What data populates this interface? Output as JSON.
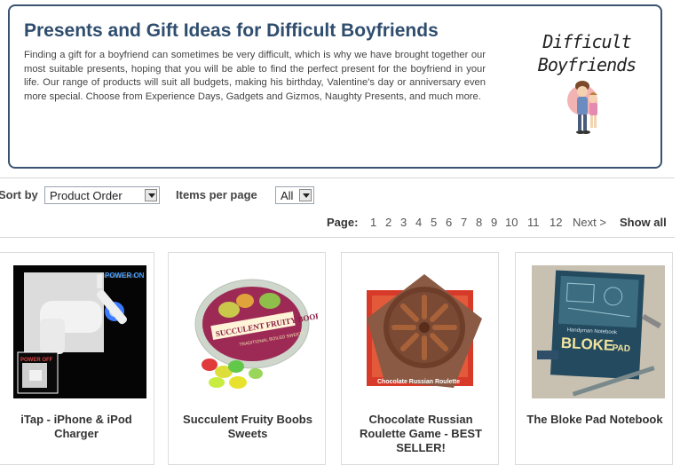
{
  "banner": {
    "title": "Presents and Gift Ideas for Difficult Boyfriends",
    "description": "Finding a gift for a boyfriend can sometimes be very difficult, which is why we have brought together our most suitable presents, hoping that you will be able to find the perfect present for the boyfriend in your life. Our range of products will suit all budgets, making his birthday, Valentine's day or anniversary even more special. Choose from Experience Days, Gadgets and Gizmos, Naughty Presents, and much more.",
    "logo_line1": "Difficult",
    "logo_line2": "Boyfriends"
  },
  "sortbar": {
    "sort_label": "Sort by",
    "sort_value": "Product Order",
    "items_label": "Items per page",
    "items_value": "All"
  },
  "pager": {
    "label": "Page:",
    "pages": [
      "1",
      "2",
      "3",
      "4",
      "5",
      "6",
      "7",
      "8",
      "9",
      "10",
      "11",
      "12"
    ],
    "next": "Next >",
    "show_all": "Show all"
  },
  "products": [
    {
      "title": "iTap - iPhone & iPod Charger",
      "image_text": "POWER ON",
      "image_text2": "POWER OFF"
    },
    {
      "title": "Succulent Fruity Boobs Sweets",
      "image_text": "SUCCULENT FRUITY BOOBS",
      "image_text2": "TRADITIONAL BOILED SWEETS"
    },
    {
      "title": "Chocolate Russian Roulette Game - BEST SELLER!",
      "image_text": "Chocolate Russian Roulette"
    },
    {
      "title": "The Bloke Pad Notebook",
      "image_text": "Handyman Notebook",
      "image_text2": "BLOKE",
      "image_text3": "PAD"
    }
  ],
  "colors": {
    "banner_border": "#3a5373",
    "title": "#2f4d6e"
  }
}
